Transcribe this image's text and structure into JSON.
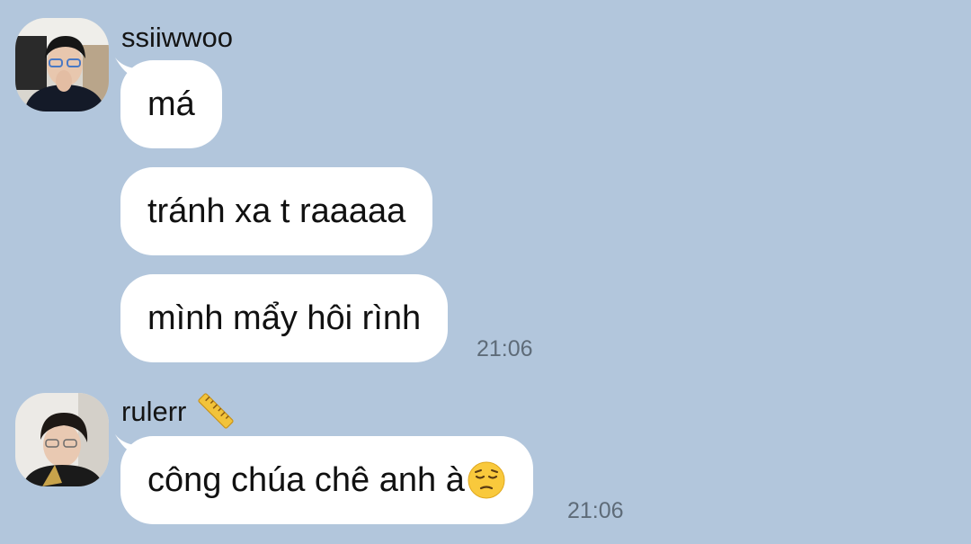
{
  "messages_group_1": {
    "sender": "ssiiwwoo",
    "avatar_icon": "user-avatar-photo",
    "messages": [
      "má",
      "tránh xa t raaaaa",
      "mình mẩy hôi rình"
    ],
    "time": "21:06"
  },
  "messages_group_2": {
    "sender": "rulerr",
    "sender_icon": "ruler-emoji-icon",
    "avatar_icon": "user-avatar-photo",
    "message": "công chúa chê anh à",
    "message_emoji": "pensive-face-emoji",
    "time": "21:06"
  },
  "colors": {
    "background": "#b2c6dc",
    "bubble": "#ffffff",
    "time_text": "#5e6b78"
  }
}
